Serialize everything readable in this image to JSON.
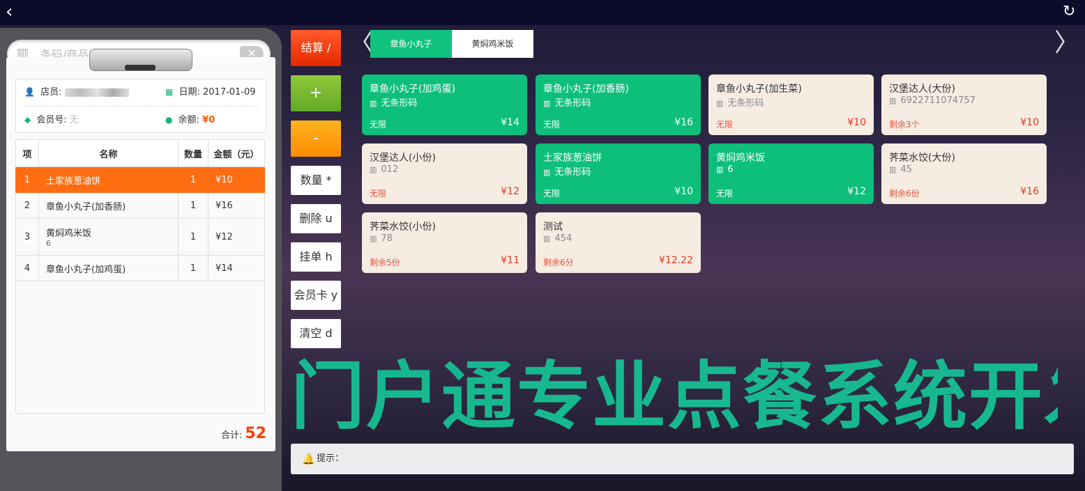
{
  "topbar": {
    "back_icon": "chevron-left-icon",
    "refresh_icon": "refresh-icon"
  },
  "search": {
    "placeholder": "条码/商品名称",
    "clear": "✕"
  },
  "info": {
    "clerk_label": "店员:",
    "date_label": "日期:",
    "date_value": "2017-01-09",
    "member_label": "会员号:",
    "member_value": "无",
    "balance_label": "余额:",
    "balance_value": "¥0"
  },
  "order": {
    "headers": {
      "idx": "项",
      "name": "名称",
      "qty": "数量",
      "amount": "金额（元）"
    },
    "rows": [
      {
        "idx": "1",
        "name": "土家族葱油饼",
        "sub": "",
        "qty": "1",
        "amount": "¥10",
        "selected": true
      },
      {
        "idx": "2",
        "name": "章鱼小丸子(加香肠)",
        "sub": "",
        "qty": "1",
        "amount": "¥16",
        "selected": false
      },
      {
        "idx": "3",
        "name": "黄焖鸡米饭",
        "sub": "6",
        "qty": "1",
        "amount": "¥12",
        "selected": false
      },
      {
        "idx": "4",
        "name": "章鱼小丸子(加鸡蛋)",
        "sub": "",
        "qty": "1",
        "amount": "¥14",
        "selected": false
      }
    ],
    "total_label": "合计:",
    "total_value": "52"
  },
  "actions": {
    "checkout": "结算 /",
    "plus": "+",
    "minus": "-",
    "quantity": "数量 *",
    "delete": "删除 u",
    "hold": "挂单 h",
    "member_card": "会员卡 y",
    "clear": "清空 d"
  },
  "categories": [
    {
      "label": "章鱼小丸子",
      "active": true
    },
    {
      "label": "黄焖鸡米饭",
      "active": false
    }
  ],
  "products": [
    {
      "name": "章鱼小丸子(加鸡蛋)",
      "code": "无条形码",
      "stock": "无限",
      "price": "¥14",
      "style": "green"
    },
    {
      "name": "章鱼小丸子(加香肠)",
      "code": "无条形码",
      "stock": "无限",
      "price": "¥16",
      "style": "green"
    },
    {
      "name": "章鱼小丸子(加生菜)",
      "code": "无条形码",
      "stock": "无限",
      "price": "¥10",
      "style": "beige"
    },
    {
      "name": "汉堡达人(大份)",
      "code": "6922711074757",
      "stock": "剩余3个",
      "price": "¥10",
      "style": "beige"
    },
    {
      "name": "汉堡达人(小份)",
      "code": "012",
      "stock": "无限",
      "price": "¥12",
      "style": "beige"
    },
    {
      "name": "土家族葱油饼",
      "code": "无条形码",
      "stock": "无限",
      "price": "¥10",
      "style": "green"
    },
    {
      "name": "黄焖鸡米饭",
      "code": "6",
      "stock": "无限",
      "price": "¥12",
      "style": "green"
    },
    {
      "name": "荠菜水饺(大份)",
      "code": "45",
      "stock": "剩余6份",
      "price": "¥16",
      "style": "beige"
    },
    {
      "name": "荠菜水饺(小份)",
      "code": "78",
      "stock": "剩余5份",
      "price": "¥11",
      "style": "beige"
    },
    {
      "name": "测试",
      "code": "454",
      "stock": "剩余6分",
      "price": "¥12.22",
      "style": "beige"
    }
  ],
  "watermark": "门户通专业点餐系统开发",
  "hint": {
    "label": "提示："
  },
  "colors": {
    "accent_green": "#0dbf7b",
    "selected_orange": "#ff6d12",
    "checkout_red": "#e62a00"
  }
}
